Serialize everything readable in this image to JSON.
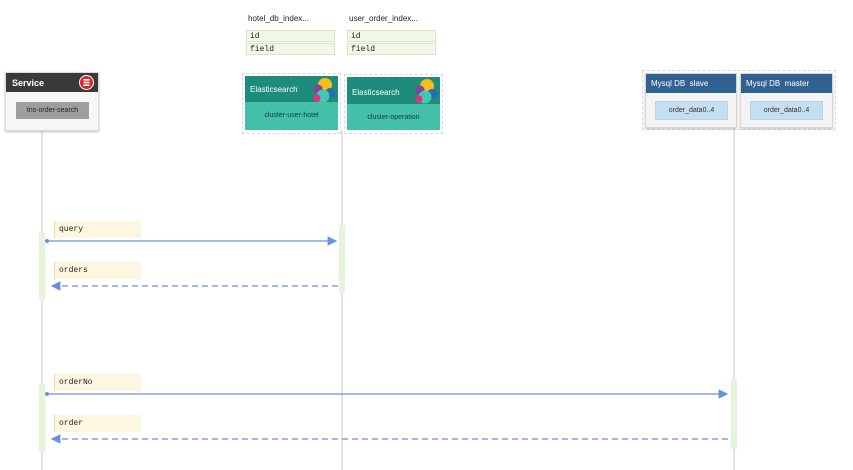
{
  "indexes": [
    {
      "title": "hotel_db_index...",
      "fields": [
        "id",
        "field"
      ]
    },
    {
      "title": "user_order_index...",
      "fields": [
        "id",
        "field"
      ]
    }
  ],
  "service": {
    "title": "Service",
    "label": "tns-order-search",
    "icon": "database-stack-icon"
  },
  "elasticsearch": [
    {
      "title": "Elasticsearch",
      "cluster": "cluster-user-hotel",
      "icon": "elasticsearch-logo-icon"
    },
    {
      "title": "Elasticsearch",
      "cluster": "cluster-operation",
      "icon": "elasticsearch-logo-icon"
    }
  ],
  "mysql": [
    {
      "title": "Mysql DB  slave",
      "table": "order_data0..4"
    },
    {
      "title": "Mysql DB  master",
      "table": "order_data0..4"
    }
  ],
  "messages": [
    "query",
    "orders",
    "orderNo",
    "order"
  ],
  "colors": {
    "arrow": "#6b8fe0",
    "es_header": "#1e8c7a",
    "es_body": "#44c0a9",
    "mysql_header": "#31628f",
    "service_header": "#3a3a3a"
  }
}
